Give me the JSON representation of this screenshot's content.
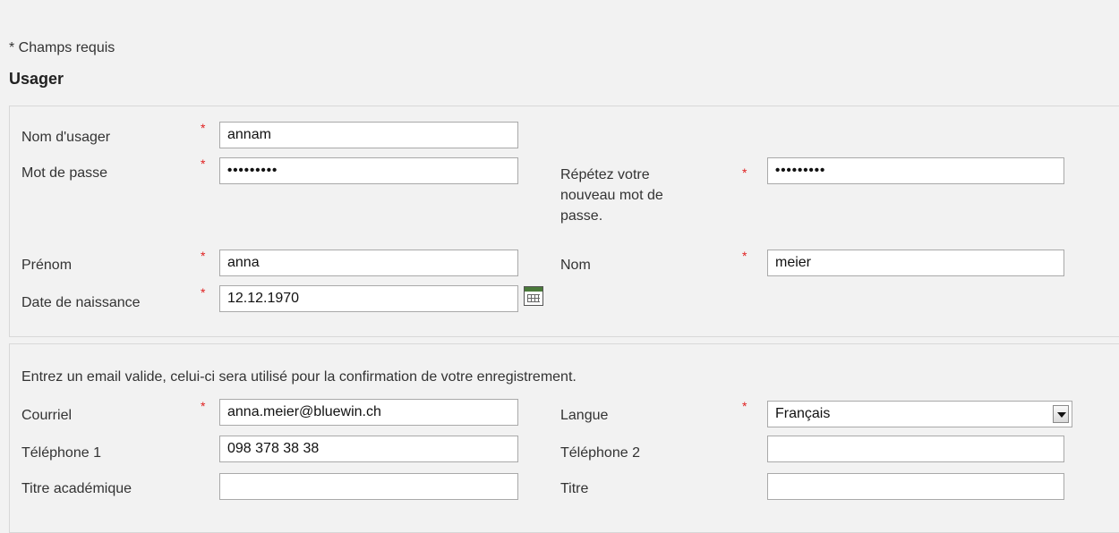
{
  "required_note": "* Champs requis",
  "section_title": "Usager",
  "user": {
    "username_label": "Nom d'usager",
    "username_value": "annam",
    "password_label": "Mot de passe",
    "password_value": "•••••••••",
    "repeat_label_line1": "Répétez votre",
    "repeat_label_line2": "nouveau mot de",
    "repeat_label_line3": "passe.",
    "repeat_value": "•••••••••",
    "firstname_label": "Prénom",
    "firstname_value": "anna",
    "lastname_label": "Nom",
    "lastname_value": "meier",
    "birthdate_label": "Date de naissance",
    "birthdate_value": "12.12.1970",
    "required_mark": "*"
  },
  "contact": {
    "intro": "Entrez un email valide, celui-ci sera utilisé pour la confirmation de votre enregistrement.",
    "email_label": "Courriel",
    "email_value": "anna.meier@bluewin.ch",
    "language_label": "Langue",
    "language_value": "Français",
    "phone1_label": "Téléphone 1",
    "phone1_value": "098 378 38 38",
    "phone2_label": "Téléphone 2",
    "phone2_value": "",
    "academic_title_label": "Titre académique",
    "academic_title_value": "",
    "title_label": "Titre",
    "title_value": ""
  },
  "colors": {
    "required": "#e02020",
    "background": "#f2f2f2",
    "calendar_header": "#4a7a3a"
  }
}
